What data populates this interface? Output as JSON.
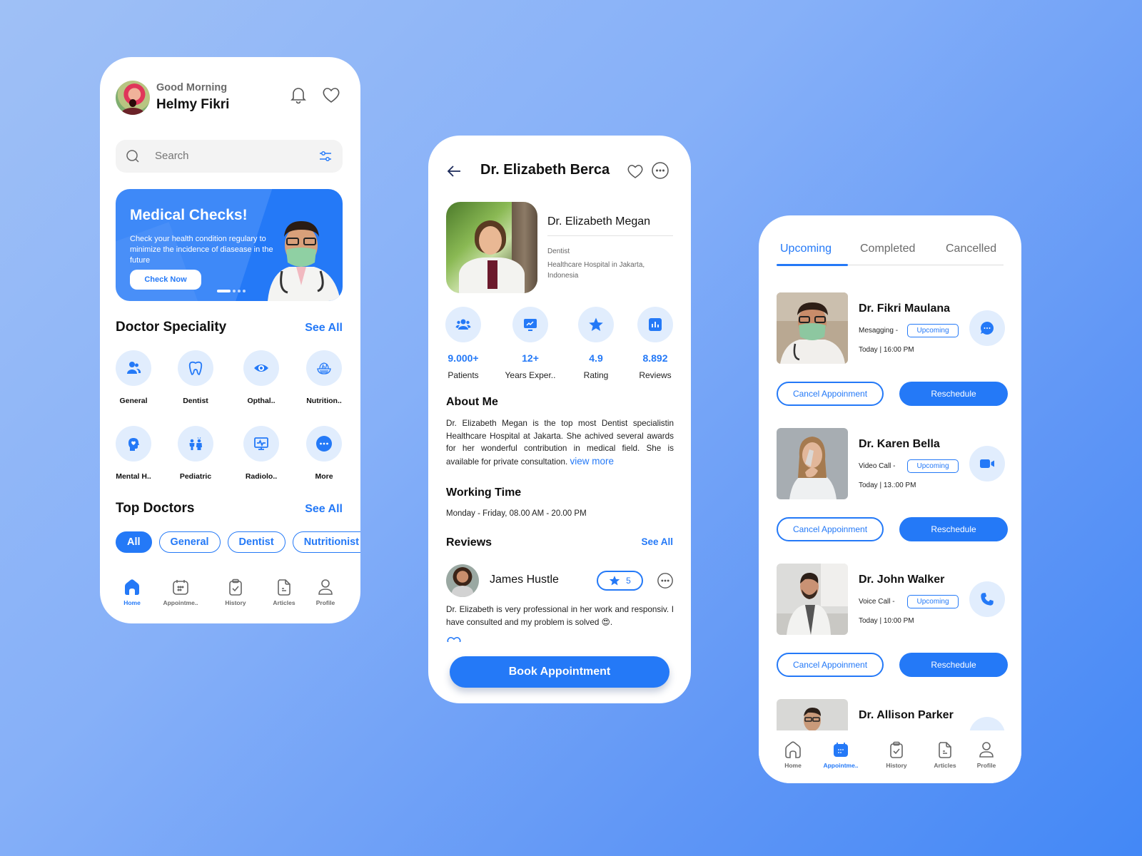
{
  "colors": {
    "accent": "#2479f7",
    "accent_light": "#e1edfd",
    "text": "#111111",
    "muted": "#6b6b6b"
  },
  "home": {
    "greeting": "Good Morning",
    "user_name": "Helmy Fikri",
    "icons": {
      "notification": "bell-icon",
      "favorites": "heart-icon"
    },
    "search": {
      "placeholder": "Search",
      "filter_icon": "sliders-icon"
    },
    "banner": {
      "title": "Medical Checks!",
      "text": "Check your health condition regulary to minimize the incidence of diasease in the future",
      "button": "Check Now",
      "slides": 4,
      "active_slide": 1
    },
    "speciality": {
      "title": "Doctor Speciality",
      "see_all": "See All",
      "items": [
        {
          "label": "General",
          "icon": "users-icon"
        },
        {
          "label": "Dentist",
          "icon": "tooth-icon"
        },
        {
          "label": "Opthal..",
          "icon": "eye-icon"
        },
        {
          "label": "Nutrition..",
          "icon": "food-bowl-icon"
        },
        {
          "label": "Mental H..",
          "icon": "head-heart-icon"
        },
        {
          "label": "Pediatric",
          "icon": "children-icon"
        },
        {
          "label": "Radiolo..",
          "icon": "monitor-pulse-icon"
        },
        {
          "label": "More",
          "icon": "more-dots-icon"
        }
      ]
    },
    "top_doctors": {
      "title": "Top Doctors",
      "see_all": "See All",
      "filters": [
        "All",
        "General",
        "Dentist",
        "Nutritionist"
      ],
      "active_filter": "All"
    },
    "nav": [
      {
        "label": "Home",
        "icon": "home-icon",
        "active": true
      },
      {
        "label": "Appointme..",
        "icon": "calendar-icon",
        "active": false
      },
      {
        "label": "History",
        "icon": "clipboard-check-icon",
        "active": false
      },
      {
        "label": "Articles",
        "icon": "document-icon",
        "active": false
      },
      {
        "label": "Profile",
        "icon": "user-icon",
        "active": false
      }
    ]
  },
  "detail": {
    "title": "Dr. Elizabeth Berca",
    "doctor_name": "Dr. Elizabeth Megan",
    "speciality": "Dentist",
    "hospital": "Healthcare Hospital in Jakarta, Indonesia",
    "stats": [
      {
        "value": "9.000+",
        "label": "Patients",
        "icon": "patients-icon"
      },
      {
        "value": "12+",
        "label": "Years Exper..",
        "icon": "chart-monitor-icon"
      },
      {
        "value": "4.9",
        "label": "Rating",
        "icon": "star-icon"
      },
      {
        "value": "8.892",
        "label": "Reviews",
        "icon": "bar-chart-icon"
      }
    ],
    "about_title": "About Me",
    "about_text": "Dr. Elizabeth Megan is the top most Dentist specialistin Healthcare Hospital at Jakarta. She achived several awards for her wonderful contribution in medical field. She is available for private consultation.",
    "view_more": "view more",
    "working_title": "Working Time",
    "working_text": "Monday - Friday, 08.00 AM - 20.00 PM",
    "reviews_title": "Reviews",
    "reviews_see_all": "See All",
    "review": {
      "name": "James Hustle",
      "rating": "5",
      "text": "Dr. Elizabeth is very professional in her work and responsiv. I have consulted and my problem is solved 😍."
    },
    "book_button": "Book Appointment"
  },
  "appointments": {
    "tabs": [
      "Upcoming",
      "Completed",
      "Cancelled"
    ],
    "active_tab": "Upcoming",
    "items": [
      {
        "name": "Dr. Fikri Maulana",
        "type": "Mesagging -",
        "status": "Upcoming",
        "time": "Today | 16:00 PM",
        "action_icon": "chat-bubble-icon"
      },
      {
        "name": "Dr. Karen Bella",
        "type": "Video Call -",
        "status": "Upcoming",
        "time": "Today | 13.:00 PM",
        "action_icon": "video-camera-icon"
      },
      {
        "name": "Dr. John Walker",
        "type": "Voice Call -",
        "status": "Upcoming",
        "time": "Today | 10:00 PM",
        "action_icon": "phone-icon"
      },
      {
        "name": "Dr. Allison Parker",
        "type": "",
        "status": "",
        "time": "",
        "action_icon": ""
      }
    ],
    "cancel_label": "Cancel Appoinment",
    "reschedule_label": "Reschedule",
    "nav": [
      {
        "label": "Home",
        "icon": "home-icon",
        "active": false
      },
      {
        "label": "Appointme..",
        "icon": "calendar-icon",
        "active": true
      },
      {
        "label": "History",
        "icon": "clipboard-check-icon",
        "active": false
      },
      {
        "label": "Articles",
        "icon": "document-icon",
        "active": false
      },
      {
        "label": "Profile",
        "icon": "user-icon",
        "active": false
      }
    ]
  }
}
